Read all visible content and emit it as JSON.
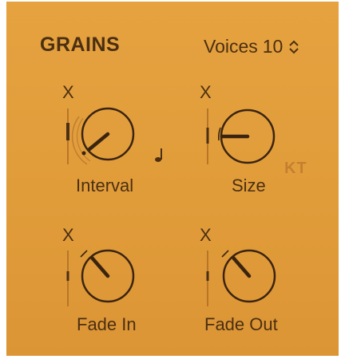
{
  "section": {
    "title": "GRAINS",
    "voices_label": "Voices",
    "voices_value": "10"
  },
  "knobs": [
    {
      "label": "Interval",
      "mod_label": "X",
      "value": 0.28
    },
    {
      "label": "Size",
      "mod_label": "X",
      "value": 0.25,
      "key_tracking": "KT"
    },
    {
      "label": "Fade In",
      "mod_label": "X",
      "value": 0.12
    },
    {
      "label": "Fade Out",
      "mod_label": "X",
      "value": 0.12
    }
  ],
  "colors": {
    "panel": "#e19c3a",
    "text": "#4b2f12",
    "inactive": "#c47f2f"
  },
  "icons": {
    "voices_stepper": "up-down-chevron-icon",
    "interval_note": "eighth-note-icon"
  }
}
